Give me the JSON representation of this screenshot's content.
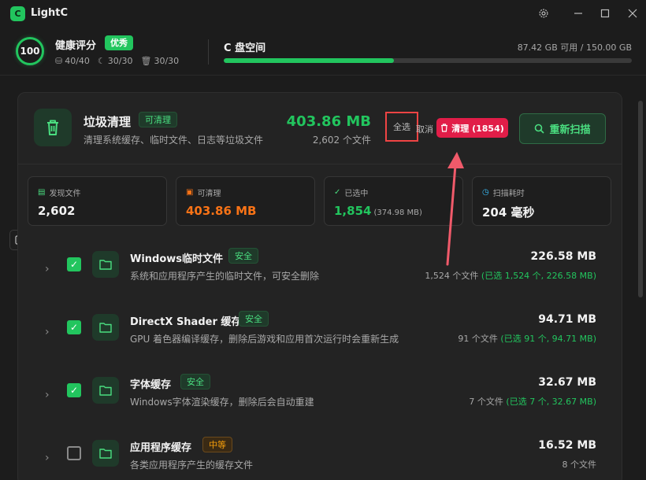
{
  "app": {
    "title": "LightC",
    "logo_glyph": "C"
  },
  "header": {
    "score": "100",
    "health_title": "健康评分",
    "health_badge": "优秀",
    "stats": [
      "40/40",
      "30/30",
      "30/30"
    ],
    "disk_title": "C 盘空间",
    "disk_info": "87.42 GB 可用 / 150.00 GB",
    "disk_used_fraction": 0.417
  },
  "cleaner": {
    "title": "垃圾清理",
    "badge": "可清理",
    "description": "清理系统缓存、临时文件、日志等垃圾文件",
    "total_size": "403.86 MB",
    "total_files": "2,602 个文件",
    "select_all": "全选",
    "cancel": "取消",
    "clean_button": "清理 (1854)",
    "rescan_button": "重新扫描"
  },
  "stat_cards": [
    {
      "label": "发现文件",
      "value": "2,602",
      "sub": ""
    },
    {
      "label": "可清理",
      "value": "403.86 MB",
      "sub": ""
    },
    {
      "label": "已选中",
      "value": "1,854",
      "sub": "(374.98 MB)"
    },
    {
      "label": "扫描耗时",
      "value": "204 毫秒",
      "sub": ""
    }
  ],
  "items": [
    {
      "title": "Windows临时文件",
      "badge": "安全",
      "desc": "系统和应用程序产生的临时文件，可安全删除",
      "size": "226.58 MB",
      "files": "1,524 个文件",
      "selected": "(已选 1,524 个, 226.58 MB)",
      "checked": true
    },
    {
      "title": "DirectX Shader 缓存",
      "badge": "安全",
      "desc": "GPU 着色器编译缓存，删除后游戏和应用首次运行时会重新生成",
      "size": "94.71 MB",
      "files": "91 个文件",
      "selected": "(已选 91 个, 94.71 MB)",
      "checked": true
    },
    {
      "title": "字体缓存",
      "badge": "安全",
      "desc": "Windows字体渲染缓存，删除后会自动重建",
      "size": "32.67 MB",
      "files": "7 个文件",
      "selected": "(已选 7 个, 32.67 MB)",
      "checked": true
    },
    {
      "title": "应用程序缓存",
      "badge": "中等",
      "desc": "各类应用程序产生的缓存文件",
      "size": "16.52 MB",
      "files": "8 个文件",
      "selected": "",
      "checked": false
    }
  ],
  "colors": {
    "accent": "#22c55e",
    "danger": "#e11d48",
    "warn": "#f59e0b",
    "bg": "#1c1c1c"
  }
}
